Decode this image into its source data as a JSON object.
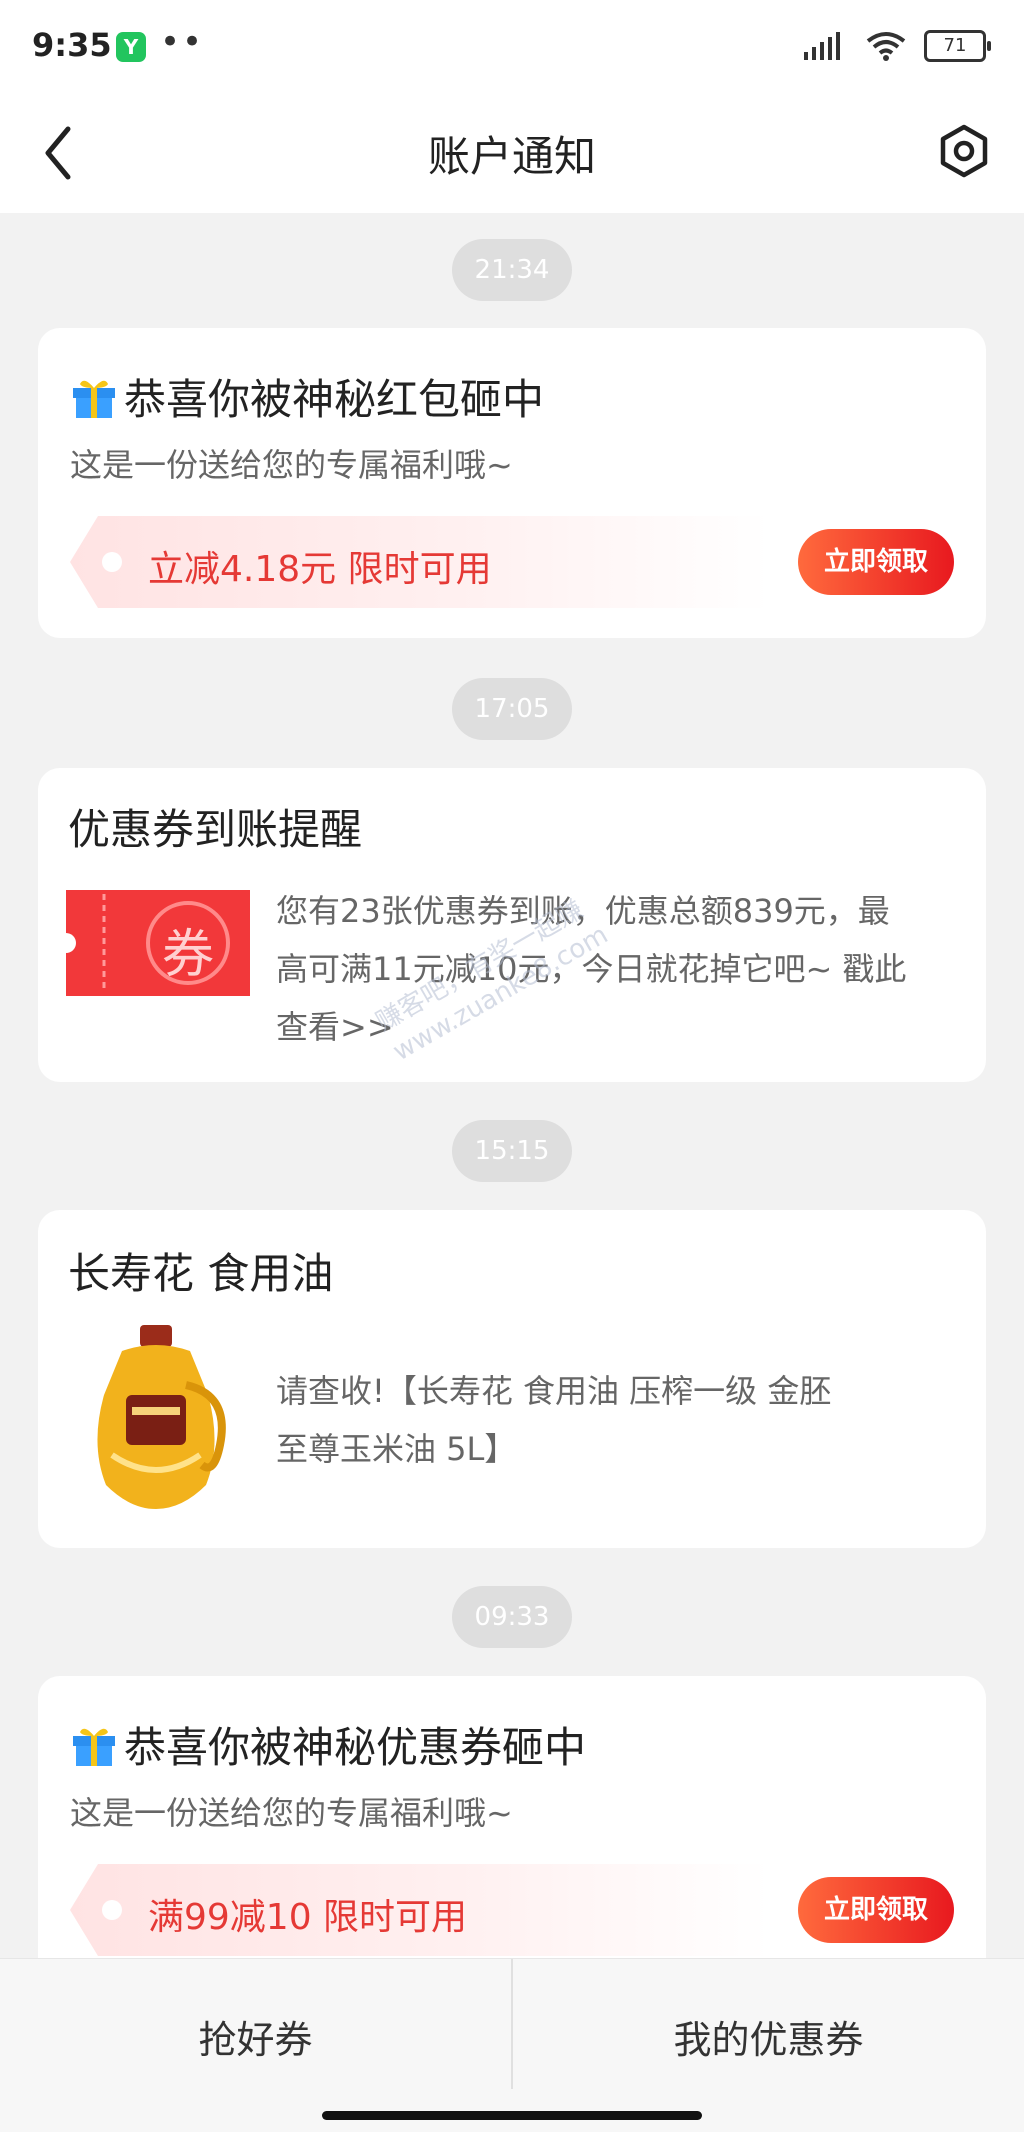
{
  "status": {
    "time": "9:35",
    "app_badge": "Y",
    "dots": "••",
    "battery": "71"
  },
  "nav": {
    "title": "账户通知"
  },
  "messages": [
    {
      "time": "21:34",
      "title": "恭喜你被神秘红包砸中",
      "subtitle": "这是一份送给您的专属福利哦~",
      "ticket": "立减4.18元 限时可用",
      "button": "立即领取"
    },
    {
      "time": "17:05",
      "title": "优惠券到账提醒",
      "coupon_glyph": "券",
      "body_lines": [
        "您有23张优惠券到账，优惠总额839元，最",
        "高可满11元减10元，今日就花掉它吧~ 戳此",
        "查看>>"
      ]
    },
    {
      "time": "15:15",
      "title": "长寿花 食用油",
      "body_lines": [
        "请查收!【长寿花 食用油 压榨一级 金胚",
        "至尊玉米油 5L】"
      ]
    },
    {
      "time": "09:33",
      "title": "恭喜你被神秘优惠券砸中",
      "subtitle": "这是一份送给您的专属福利哦~",
      "ticket": "满99减10 限时可用",
      "button": "立即领取"
    }
  ],
  "watermark": {
    "line1": "赚客吧，有奖一起赚",
    "line2": "www.zuanke8.com"
  },
  "bottom_tabs": {
    "left": "抢好券",
    "right": "我的优惠券"
  },
  "colors": {
    "accent_red": "#e8191f",
    "page_bg": "#f2f2f2"
  }
}
